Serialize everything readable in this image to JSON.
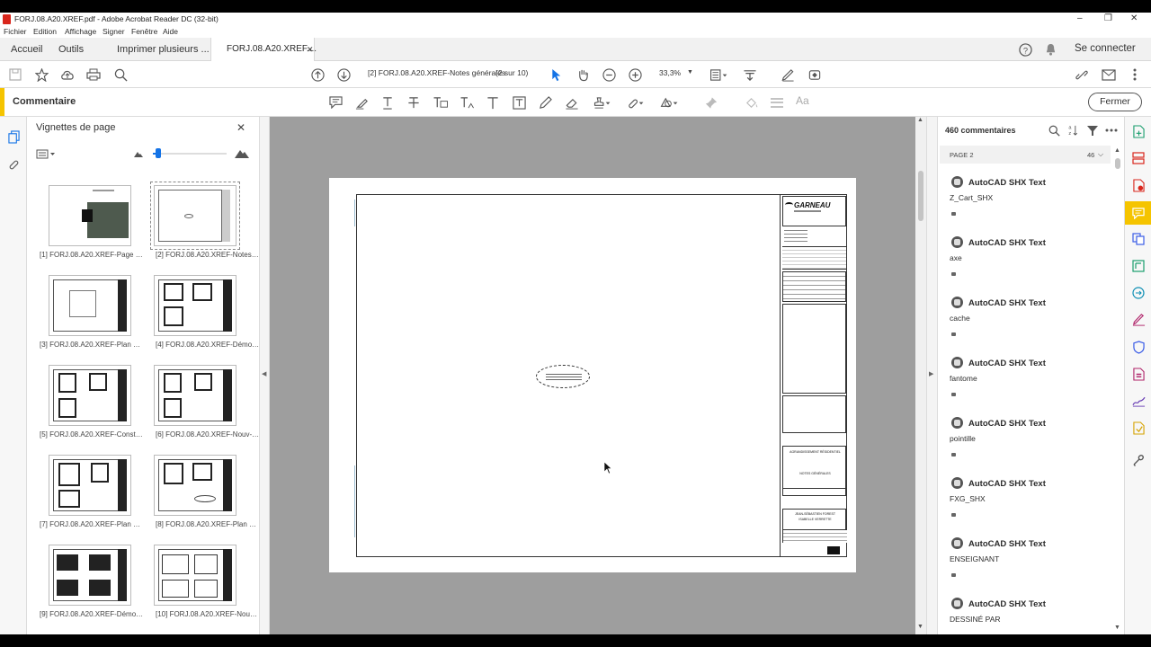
{
  "window": {
    "title": "FORJ.08.A20.XREF.pdf - Adobe Acrobat Reader DC (32-bit)",
    "controls": [
      "–",
      "❐",
      "✕"
    ]
  },
  "menu": [
    "Fichier",
    "Edition",
    "Affichage",
    "Signer",
    "Fenêtre",
    "Aide"
  ],
  "tabs": {
    "home": "Accueil",
    "tools": "Outils",
    "doc1": "Imprimer plusieurs ...",
    "doc2": "FORJ.08.A20.XREF....",
    "close": "✕"
  },
  "account": {
    "sign_in": "Se connecter"
  },
  "toolbar": {
    "page_label": "[2] FORJ.08.A20.XREF-Notes générales",
    "page_of": "(2 sur 10)",
    "zoom": "33,3%"
  },
  "comment_toolbar": {
    "title": "Commentaire",
    "close": "Fermer"
  },
  "thumbnails": {
    "title": "Vignettes de page",
    "items": [
      {
        "label": "[1] FORJ.08.A20.XREF-Page fro..."
      },
      {
        "label": "[2] FORJ.08.A20.XREF-Notes g..."
      },
      {
        "label": "[3] FORJ.08.A20.XREF-Plan d'i..."
      },
      {
        "label": "[4] FORJ.08.A20.XREF-Démoliti..."
      },
      {
        "label": "[5] FORJ.08.A20.XREF-Constru..."
      },
      {
        "label": "[6] FORJ.08.A20.XREF-Nouv-A..."
      },
      {
        "label": "[7] FORJ.08.A20.XREF-Plan éle..."
      },
      {
        "label": "[8] FORJ.08.A20.XREF-Plan pla..."
      },
      {
        "label": "[9] FORJ.08.A20.XREF-Démol. ..."
      },
      {
        "label": "[10] FORJ.08.A20.XREF-Nouv. ..."
      }
    ]
  },
  "document": {
    "logo_name": "GARNEAU",
    "block_title": "AGRANDISSEMENT RÉSIDENTIEL",
    "block_subtitle": "NOTES GÉNÉRALES",
    "client_line1": "JEAN-SÉBASTIEN FOREST",
    "client_line2": "ISABELLE VERRETTE"
  },
  "comments": {
    "count": "460 commentaires",
    "page_header": "PAGE 2",
    "page_count": "46",
    "items": [
      {
        "author": "AutoCAD SHX Text",
        "text": "Z_Cart_SHX"
      },
      {
        "author": "AutoCAD SHX Text",
        "text": "axe"
      },
      {
        "author": "AutoCAD SHX Text",
        "text": "cache"
      },
      {
        "author": "AutoCAD SHX Text",
        "text": "fantome"
      },
      {
        "author": "AutoCAD SHX Text",
        "text": "pointille"
      },
      {
        "author": "AutoCAD SHX Text",
        "text": "FXG_SHX"
      },
      {
        "author": "AutoCAD SHX Text",
        "text": "ENSEIGNANT"
      },
      {
        "author": "AutoCAD SHX Text",
        "text": "DESSINÉ PAR"
      }
    ]
  },
  "colors": {
    "accent_blue": "#1473e6",
    "comment_yellow": "#f5c400",
    "pdf_red": "#d9261c",
    "canvas_gray": "#9e9e9e"
  }
}
